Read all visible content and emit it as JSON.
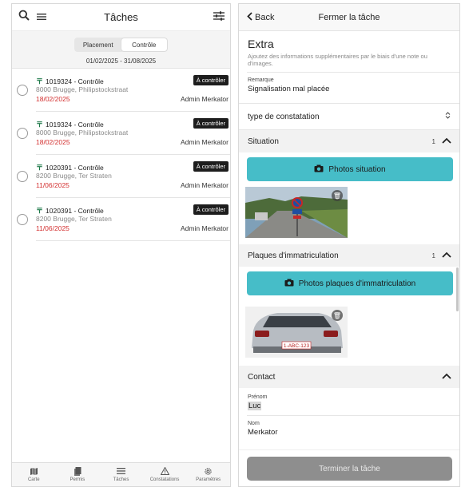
{
  "left": {
    "header": {
      "title": "Tâches"
    },
    "segment": {
      "options": [
        "Placement",
        "Contrôle"
      ],
      "active": "Contrôle"
    },
    "date_range": "01/02/2025 - 31/08/2025",
    "tasks": [
      {
        "id_line": "1019324 - Contrôle",
        "address": "8000 Brugge, Philipstockstraat",
        "date": "18/02/2025",
        "badge": "À contrôler",
        "assignee": "Admin Merkator"
      },
      {
        "id_line": "1019324 - Contrôle",
        "address": "8000 Brugge, Philipstockstraat",
        "date": "18/02/2025",
        "badge": "À contrôler",
        "assignee": "Admin Merkator"
      },
      {
        "id_line": "1020391 - Contrôle",
        "address": "8200 Brugge, Ter Straten",
        "date": "11/06/2025",
        "badge": "À contrôler",
        "assignee": "Admin Merkator"
      },
      {
        "id_line": "1020391 - Contrôle",
        "address": "8200 Brugge, Ter Straten",
        "date": "11/06/2025",
        "badge": "À contrôler",
        "assignee": "Admin Merkator"
      }
    ],
    "nav": [
      {
        "label": "Carte",
        "icon": "map-icon"
      },
      {
        "label": "Permis",
        "icon": "permits-icon"
      },
      {
        "label": "Tâches",
        "icon": "list-icon"
      },
      {
        "label": "Constatations",
        "icon": "warning-icon"
      },
      {
        "label": "Paramètres",
        "icon": "gear-icon"
      }
    ]
  },
  "right": {
    "header": {
      "back_label": "Back",
      "title": "Fermer la tâche"
    },
    "extra": {
      "title": "Extra",
      "description": "Ajoutez des informations supplémentaires par le biais d'une note ou d'images."
    },
    "remark": {
      "label": "Remarque",
      "value": "Signalisation mal placée"
    },
    "type_select": {
      "label": "type de constatation"
    },
    "situation": {
      "title": "Situation",
      "count": "1",
      "button": "Photos situation"
    },
    "plates": {
      "title": "Plaques d'immatriculation",
      "count": "1",
      "button": "Photos plaques d'immatriculation",
      "plate_text": "1-ABC-123"
    },
    "contact": {
      "title": "Contact",
      "first_name_label": "Prénom",
      "first_name": "Luc",
      "last_name_label": "Nom",
      "last_name": "Merkator"
    },
    "submit_label": "Terminer la tâche"
  },
  "colors": {
    "accent_teal": "#46bdc8",
    "date_red": "#d32f2f",
    "badge_dark": "#1d1d1d",
    "disabled_button": "#8e8e8e",
    "flag_green": "#1f7a4a"
  }
}
